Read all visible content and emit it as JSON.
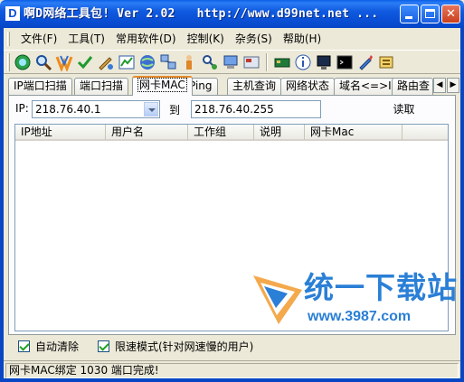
{
  "window": {
    "title": "啊D网络工具包! Ver 2.02   http://www.d99net.net ...",
    "logo_letter": "D"
  },
  "menu": [
    {
      "label": "文件(F)"
    },
    {
      "label": "工具(T)"
    },
    {
      "label": "常用软件(D)"
    },
    {
      "label": "控制(K)"
    },
    {
      "label": "杂务(S)"
    },
    {
      "label": "帮助(H)"
    }
  ],
  "toolbar": {
    "icons": [
      "globe-scan-icon",
      "magnifier-icon",
      "winamp-icon",
      "checkmark-icon",
      "paint-icon",
      "chart-icon",
      "network-icon",
      "hosts-icon",
      "person-icon",
      "users-icon",
      "computer-icon",
      "panel-icon",
      "network-card-icon",
      "info-icon",
      "monitor-icon",
      "terminal-icon",
      "pencil-icon",
      "settings-icon"
    ]
  },
  "tabs": [
    {
      "label": "IP端口扫描"
    },
    {
      "label": "端口扫描"
    },
    {
      "label": "网卡MAC"
    },
    {
      "label": "Ping"
    },
    {
      "label": "主机查询"
    },
    {
      "label": "网络状态"
    },
    {
      "label": "域名<=>IP"
    },
    {
      "label": "路由查"
    }
  ],
  "form": {
    "ip_label": "IP:",
    "start_ip": "218.76.40.1",
    "to_label": "到",
    "end_ip": "218.76.40.255",
    "read_label": "读取"
  },
  "table": {
    "columns": [
      "IP地址",
      "用户名",
      "工作组",
      "说明",
      "网卡Mac"
    ],
    "rows": []
  },
  "watermark": {
    "text": "统一下载站",
    "url": "www.3987.com"
  },
  "options": {
    "auto_clear": {
      "label": "自动清除",
      "checked": true
    },
    "speed_limit": {
      "label": "限速模式(针对网速慢的用户)",
      "checked": true
    }
  },
  "status": {
    "text": "网卡MAC绑定 1030 端口完成!"
  },
  "colors": {
    "titlebar": "#0a50d6",
    "active_tab_accent": "#e68b2c",
    "watermark": "#2a7fd6"
  }
}
